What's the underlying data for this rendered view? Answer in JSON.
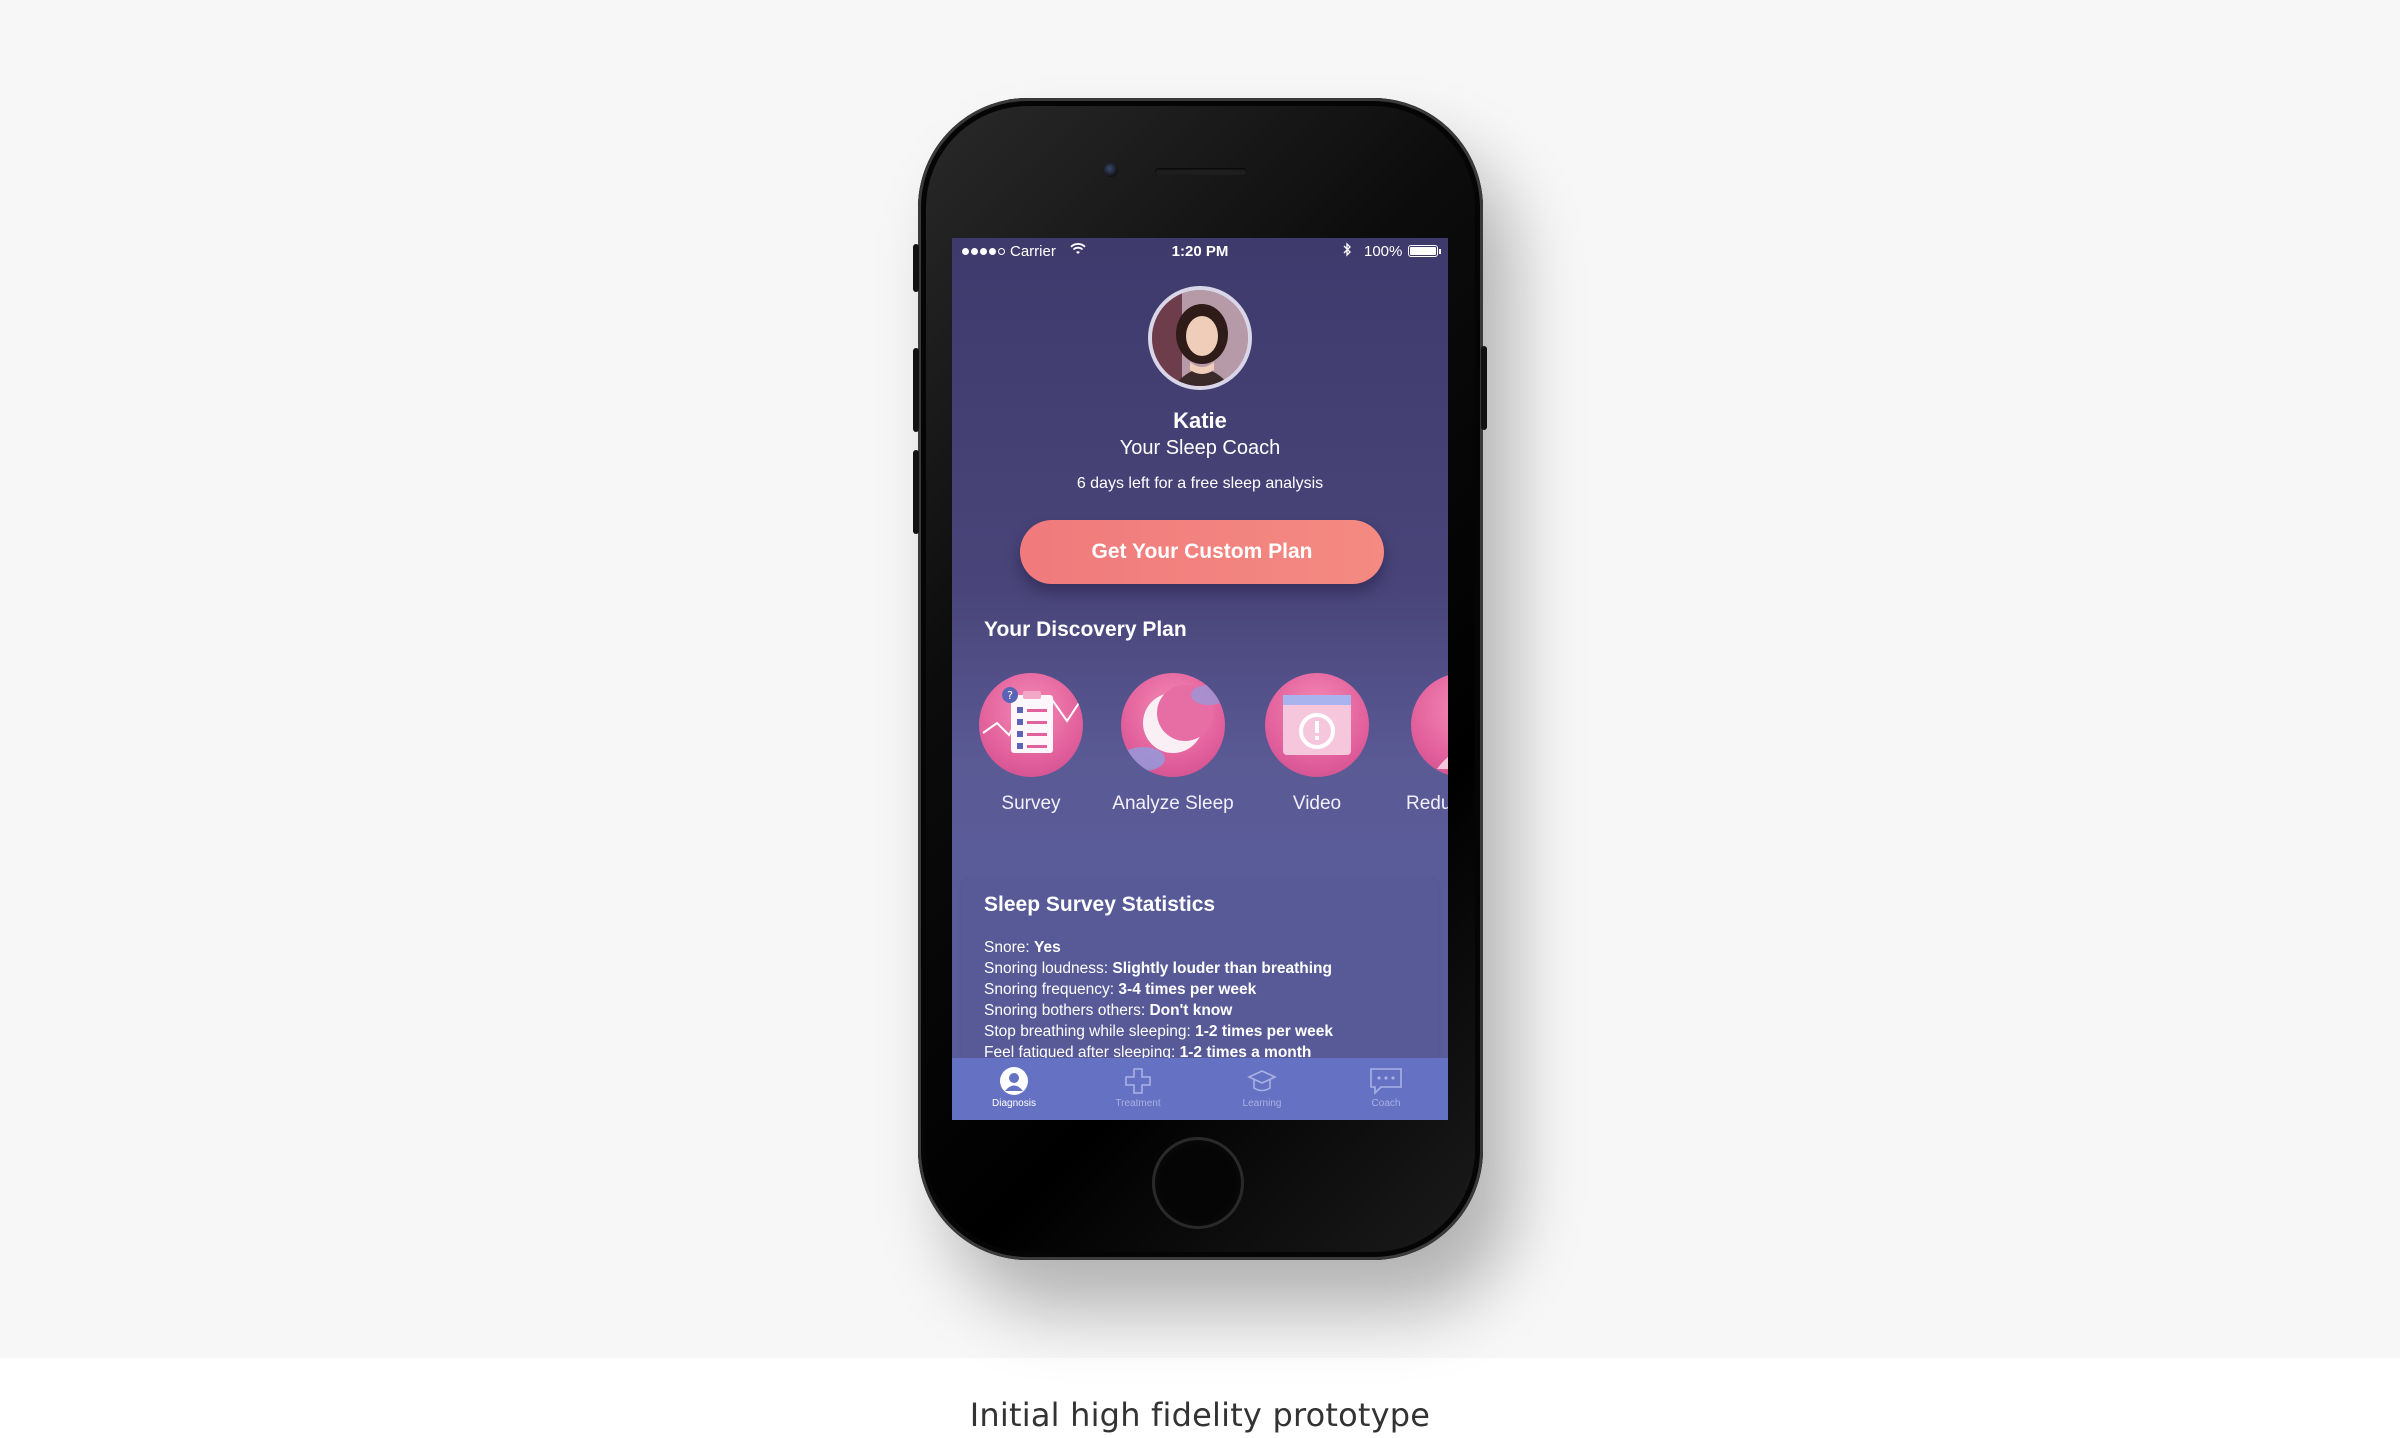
{
  "caption": "Initial high fidelity prototype",
  "status_bar": {
    "carrier": "Carrier",
    "time": "1:20 PM",
    "battery": "100%",
    "signal_bars_filled": 4,
    "signal_bars_total": 5,
    "battery_level": 1.0
  },
  "coach": {
    "name": "Katie",
    "role": "Your Sleep Coach",
    "trial_text": "6 days left for a free sleep analysis"
  },
  "cta": {
    "label": "Get Your Custom Plan"
  },
  "discovery": {
    "title": "Your Discovery Plan",
    "items": [
      {
        "label": "Survey",
        "icon": "survey-clipboard-icon"
      },
      {
        "label": "Analyze Sleep",
        "icon": "moon-cloud-icon"
      },
      {
        "label": "Video",
        "icon": "video-alert-icon"
      },
      {
        "label": "Redu",
        "icon": "person-icon"
      }
    ]
  },
  "stats": {
    "title": "Sleep Survey Statistics",
    "rows": [
      {
        "label": "Snore: ",
        "value": "Yes"
      },
      {
        "label": "Snoring loudness: ",
        "value": "Slightly louder than breathing"
      },
      {
        "label": "Snoring frequency: ",
        "value": "3-4 times per week"
      },
      {
        "label": "Snoring bothers others: ",
        "value": "Don't know"
      },
      {
        "label": "Stop breathing while sleeping: ",
        "value": "1-2 times per week"
      },
      {
        "label": "Feel fatigued after sleeping: ",
        "value": "1-2 times a month"
      }
    ]
  },
  "tabs": [
    {
      "label": "Diagnosis",
      "icon": "person-circle-icon",
      "active": true
    },
    {
      "label": "Treatment",
      "icon": "cross-icon",
      "active": false
    },
    {
      "label": "Learning",
      "icon": "graduation-cap-icon",
      "active": false
    },
    {
      "label": "Coach",
      "icon": "chat-bubble-icon",
      "active": false
    }
  ],
  "colors": {
    "cta": "#f07a7c",
    "screen_top": "#3f3a6c",
    "screen_bottom": "#5d60a0",
    "tab_bar": "#6571c2",
    "plan_icon": "#e2609c"
  }
}
